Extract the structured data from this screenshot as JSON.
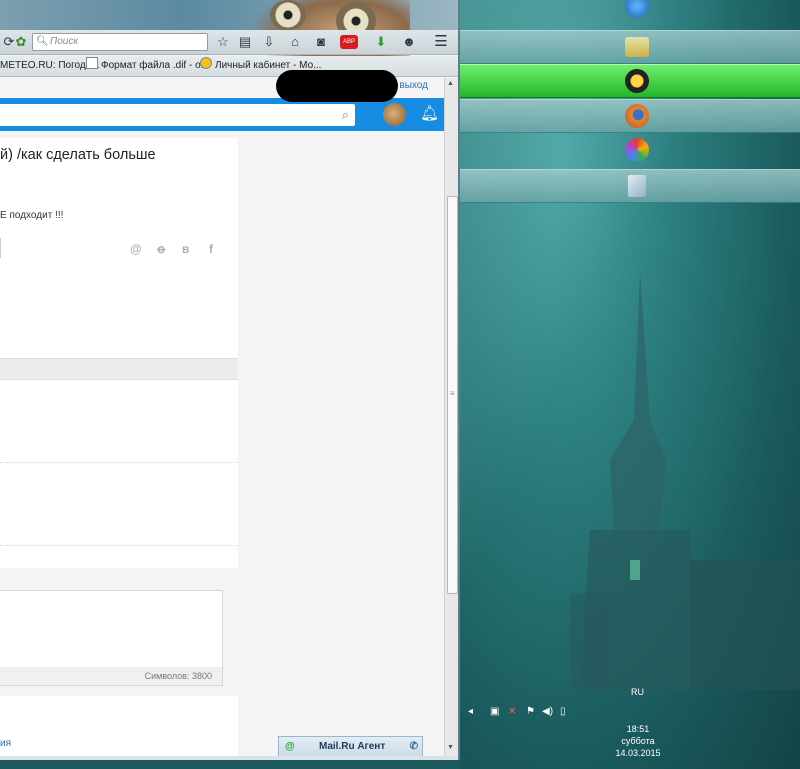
{
  "browser": {
    "search_placeholder": "Поиск",
    "toolbar_icons": [
      "reload-icon",
      "search-icon",
      "star-icon",
      "bookmarks-icon",
      "download-icon",
      "home-icon",
      "pocket-icon",
      "adblock-icon",
      "green-download-icon",
      "smiley-icon",
      "menu-icon"
    ],
    "adblock_label": "ABP",
    "bookmarks": [
      "METEO.RU: Погода...",
      "Формат файла .dif - о...",
      "Личный кабинет - Мо..."
    ]
  },
  "page": {
    "logout": "выход",
    "question_title": "й) /как сделать больше",
    "question_body": "Е подходит !!!",
    "share_icons": [
      "@",
      "ok",
      "в",
      "f"
    ],
    "chars_counter": "Символов: 3800",
    "bottom_link": "ия",
    "agent_label": "Mail.Ru Агент",
    "accent": "#168de2"
  },
  "desktop": {
    "dock": [
      "windows-icon",
      "folder-icon",
      "aimp-icon",
      "firefox-icon",
      "picasa-icon",
      "screenshot-tool-icon"
    ],
    "active_accent": "#3bd63b",
    "language": "RU",
    "clock": {
      "time": "18:51",
      "day": "суббота",
      "date": "14.03.2015"
    }
  }
}
